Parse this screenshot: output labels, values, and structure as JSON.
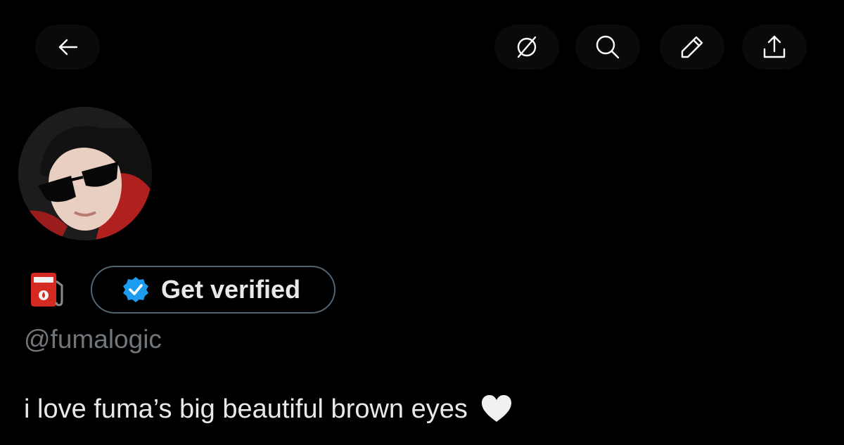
{
  "topbar": {
    "back_icon": "arrow-left-icon",
    "grok_icon": "grok-icon",
    "search_icon": "search-icon",
    "edit_icon": "pencil-icon",
    "share_icon": "share-icon"
  },
  "profile": {
    "avatar_description_icon": "avatar-photo",
    "name_emoji_icon": "fuel-pump-emoji",
    "verify_button_label": "Get verified",
    "verify_badge_icon": "verified-badge-icon",
    "handle": "@fumalogic",
    "bio_text": "i love fuma’s big beautiful brown eyes",
    "bio_emoji_icon": "white-heart-emoji"
  },
  "colors": {
    "background": "#000000",
    "primary_text": "#e7e9ea",
    "secondary_text": "#71767b",
    "border": "#536471",
    "verified_blue": "#1d9bf0"
  }
}
